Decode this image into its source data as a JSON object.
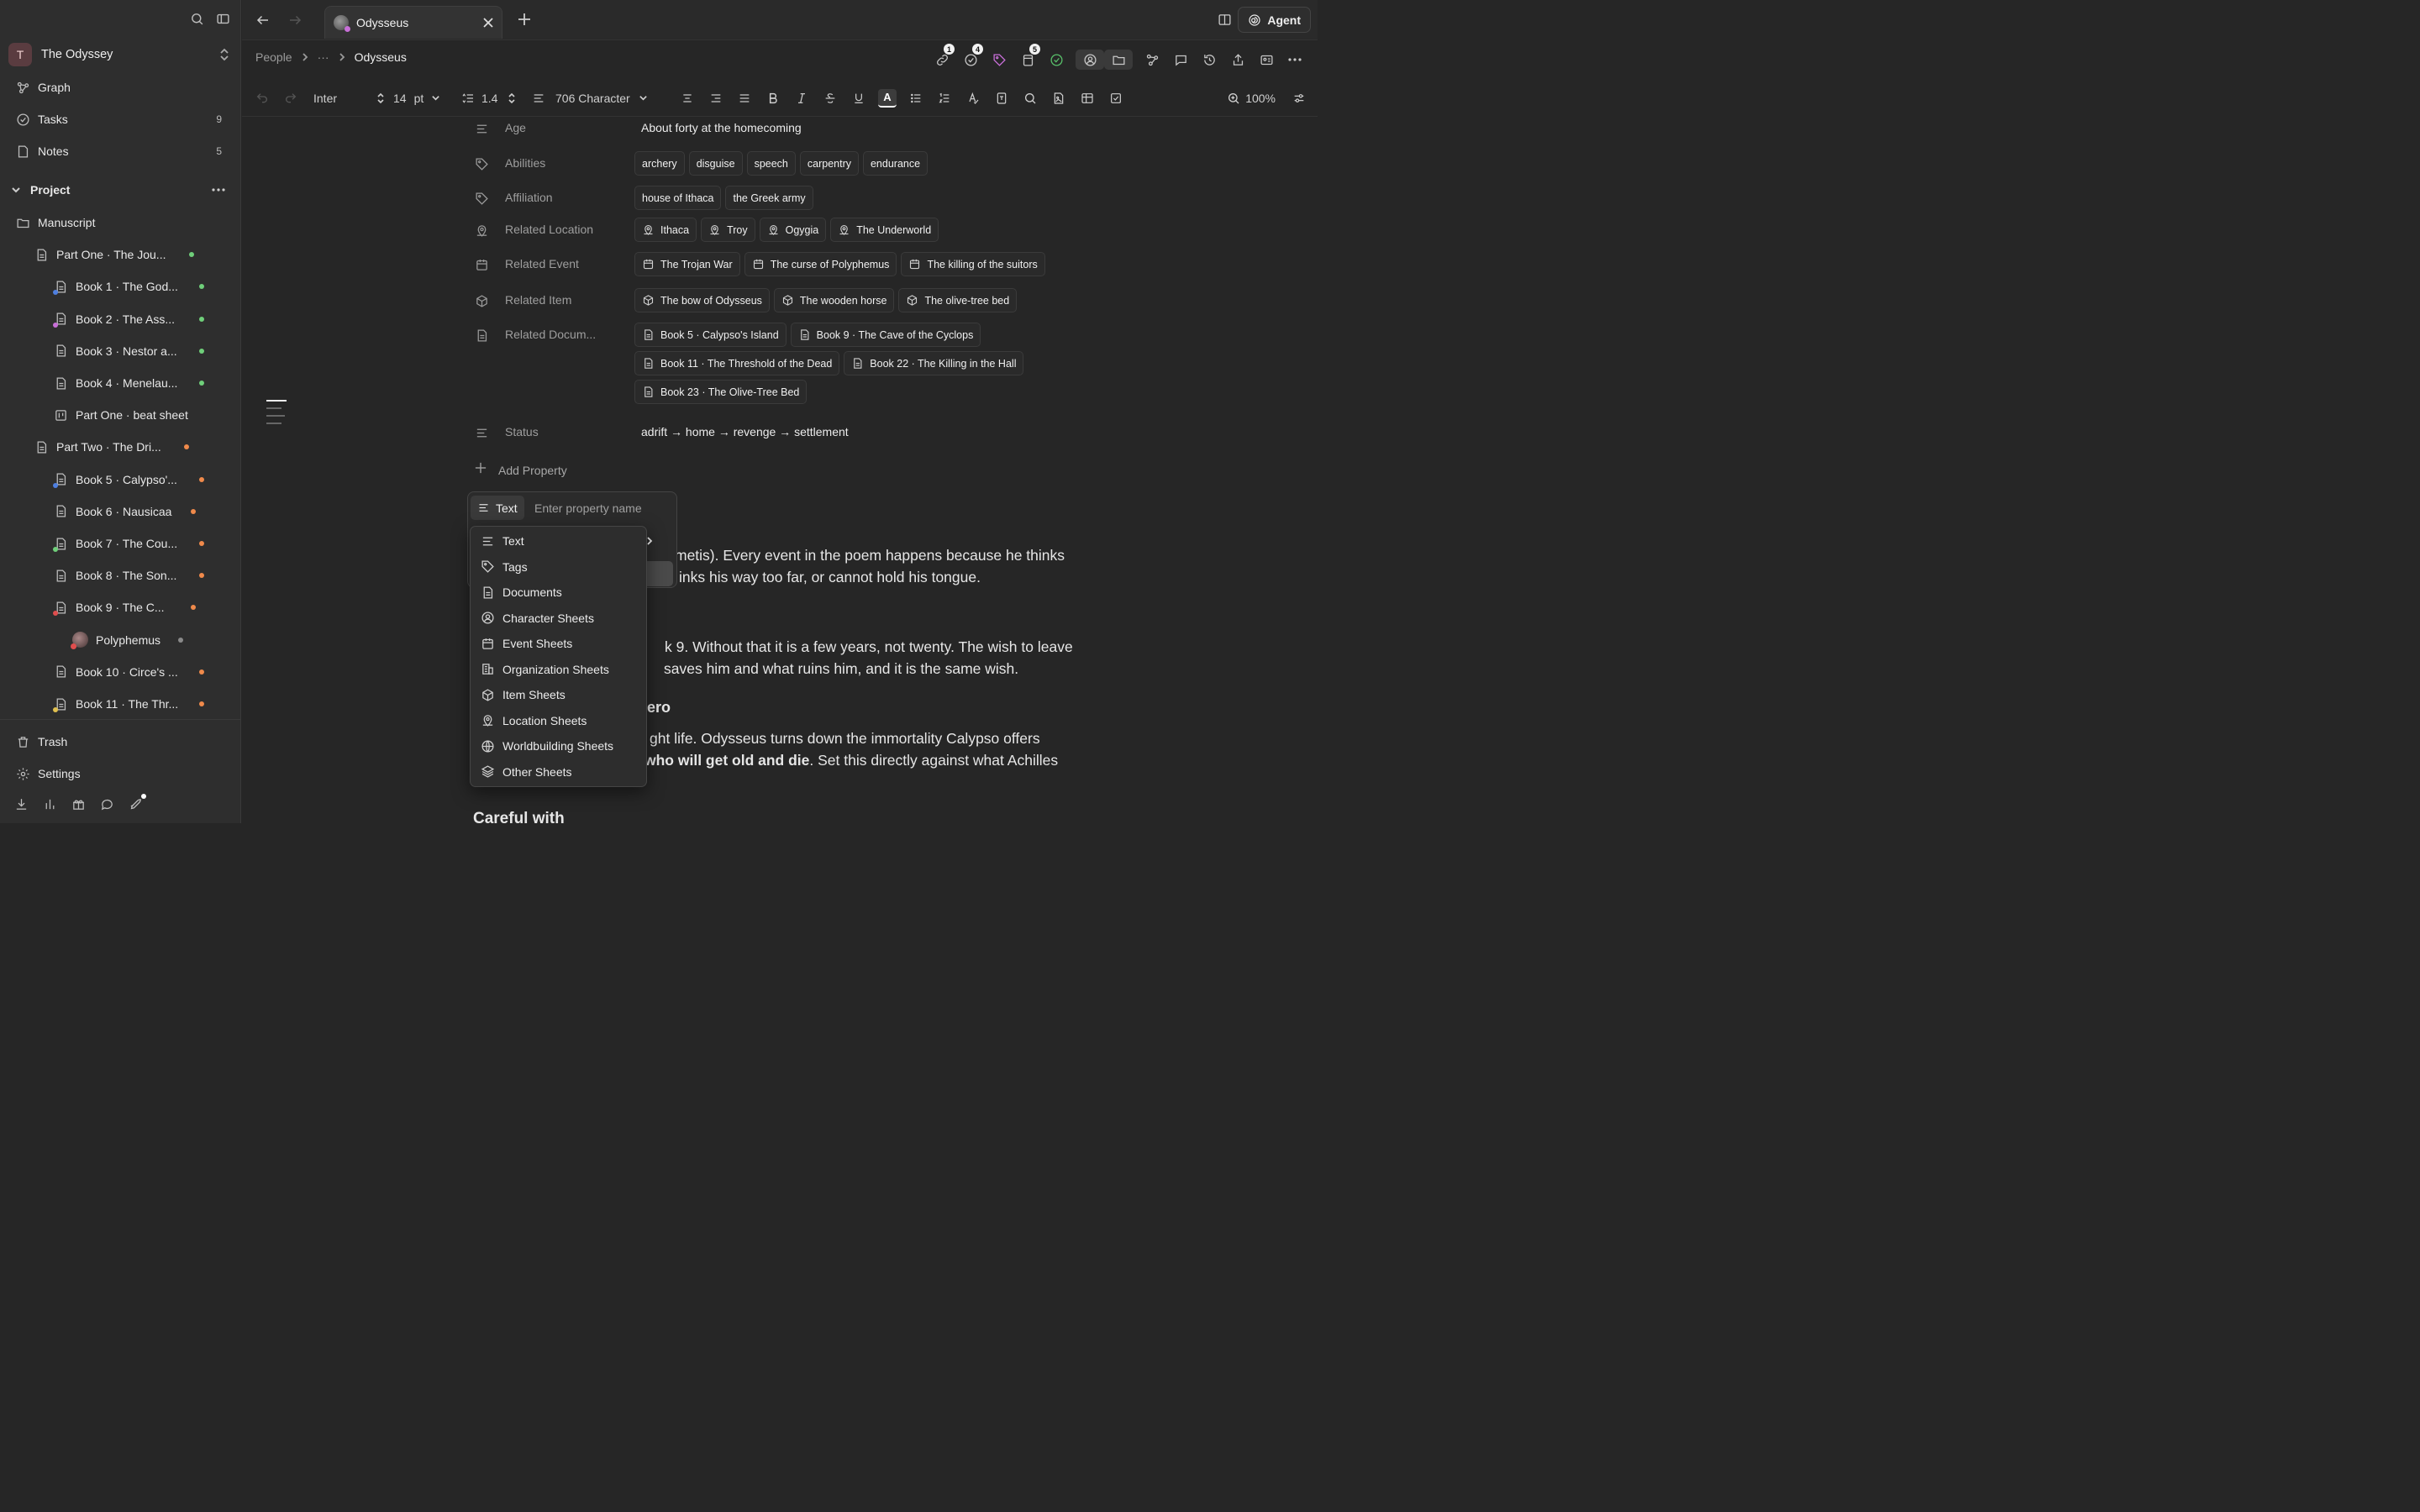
{
  "sidebar": {
    "workspace": {
      "initial": "T",
      "name": "The Odyssey"
    },
    "nav": [
      {
        "label": "Graph",
        "icon": "graph-icon"
      },
      {
        "label": "Tasks",
        "icon": "check-circle-icon",
        "count": "9"
      },
      {
        "label": "Notes",
        "icon": "note-icon",
        "count": "5"
      }
    ],
    "project_label": "Project",
    "tree": [
      {
        "label": "Manuscript",
        "icon": "folder-icon"
      },
      {
        "label": "Part One · The Jou...",
        "icon": "document-icon",
        "dot": "#6fcf7a"
      },
      {
        "label": "Book 1 · The God...",
        "icon": "document-icon",
        "dot": "#6fcf7a",
        "mini": "#4e7fe0"
      },
      {
        "label": "Book 2 · The Ass...",
        "icon": "document-icon",
        "dot": "#6fcf7a",
        "mini": "#c86fd8"
      },
      {
        "label": "Book 3 · Nestor a...",
        "icon": "document-icon",
        "dot": "#6fcf7a"
      },
      {
        "label": "Book 4 · Menelau...",
        "icon": "document-icon",
        "dot": "#6fcf7a"
      },
      {
        "label": "Part One · beat sheet",
        "icon": "beat-sheet-icon"
      },
      {
        "label": "Part Two · The Dri...",
        "icon": "document-icon",
        "dot": "#f08a4b"
      },
      {
        "label": "Book 5 · Calypso'...",
        "icon": "document-icon",
        "dot": "#f08a4b",
        "mini": "#4e7fe0"
      },
      {
        "label": "Book 6 · Nausicaa",
        "icon": "document-icon",
        "dot": "#f08a4b"
      },
      {
        "label": "Book 7 · The Cou...",
        "icon": "document-icon",
        "dot": "#f08a4b",
        "mini": "#6fcf7a"
      },
      {
        "label": "Book 8 · The Son...",
        "icon": "document-icon",
        "dot": "#f08a4b"
      },
      {
        "label": "Book 9 · The C...",
        "icon": "document-icon",
        "dot": "#f08a4b",
        "mini": "#e04e4e"
      },
      {
        "label": "Polyphemus",
        "icon": "avatar",
        "dot": "#8a8a8a"
      },
      {
        "label": "Book 10 · Circe's ...",
        "icon": "document-icon",
        "dot": "#f08a4b"
      },
      {
        "label": "Book 11 · The Thr...",
        "icon": "document-icon",
        "dot": "#f08a4b",
        "mini": "#e0c04e"
      }
    ],
    "trash": "Trash",
    "settings": "Settings"
  },
  "tabbar": {
    "tab_title": "Odysseus",
    "agent_label": "Agent"
  },
  "breadcrumb": {
    "root": "People",
    "ellipsis": "···",
    "current": "Odysseus"
  },
  "header_badges": {
    "links": "1",
    "tasks": "4",
    "docs": "5"
  },
  "toolbar": {
    "font": "Inter",
    "size": "14",
    "unit": "pt",
    "line_height": "1.4",
    "style": "706 Character",
    "zoom": "100%"
  },
  "properties": [
    {
      "name": "Age",
      "icon": "text-icon",
      "value": "About forty at the homecoming"
    },
    {
      "name": "Abilities",
      "icon": "tag-icon",
      "chips": [
        "archery",
        "disguise",
        "speech",
        "carpentry",
        "endurance"
      ]
    },
    {
      "name": "Affiliation",
      "icon": "tag-icon",
      "chips": [
        "house of Ithaca",
        "the Greek army"
      ]
    },
    {
      "name": "Related Location",
      "icon": "location-icon",
      "chips": [
        "Ithaca",
        "Troy",
        "Ogygia",
        "The Underworld"
      ]
    },
    {
      "name": "Related Event",
      "icon": "calendar-icon",
      "chips": [
        "The Trojan War",
        "The curse of Polyphemus",
        "The killing of the suitors"
      ]
    },
    {
      "name": "Related Item",
      "icon": "box-icon",
      "chips": [
        "The bow of Odysseus",
        "The wooden horse",
        "The olive-tree bed"
      ]
    },
    {
      "name": "Related Docum...",
      "icon": "document-icon",
      "chips": [
        "Book 5 · Calypso's Island",
        "Book 9 · The Cave of the Cyclops",
        "Book 11 · The Threshold of the Dead",
        "Book 22 · The Killing in the Hall",
        "Book 23 · The Olive-Tree Bed"
      ]
    },
    {
      "name": "Status",
      "icon": "text-icon",
      "value": "adrift → home → revenge → settlement"
    }
  ],
  "add_property": "Add Property",
  "popup": {
    "type_label": "Text",
    "placeholder": "Enter property name"
  },
  "menu": [
    {
      "label": "Text",
      "icon": "text-icon",
      "submenu": true
    },
    {
      "label": "Tags",
      "icon": "tag-icon"
    },
    {
      "label": "Documents",
      "icon": "document-icon"
    },
    {
      "label": "Character Sheets",
      "icon": "person-icon"
    },
    {
      "label": "Event Sheets",
      "icon": "calendar-icon"
    },
    {
      "label": "Organization Sheets",
      "icon": "building-icon"
    },
    {
      "label": "Item Sheets",
      "icon": "box-icon"
    },
    {
      "label": "Location Sheets",
      "icon": "location-icon"
    },
    {
      "label": "Worldbuilding Sheets",
      "icon": "globe-icon"
    },
    {
      "label": "Other Sheets",
      "icon": "layers-icon"
    }
  ],
  "body": {
    "p1_l1": "metis). Every event in the poem happens because he thinks",
    "p1_l2": "inks his way too far, or cannot hold his tongue.",
    "p2_l1": "k 9. Without that it is a few years, not twenty. The wish to leave",
    "p2_l2": "saves him and what ruins him, and it is the same wish.",
    "h1": "ero",
    "p3_l1": "ght life. Odysseus turns down the immortality Calypso offers",
    "p3_l2_bold": "who will get old and die",
    "p3_l2_rest": ". Set this directly against what Achilles",
    "h2": "Careful with"
  }
}
